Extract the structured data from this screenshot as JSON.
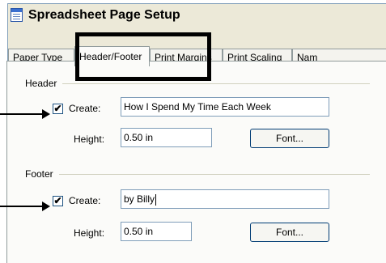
{
  "window": {
    "title": "Spreadsheet Page Setup"
  },
  "tabs": [
    {
      "label": "Paper Type"
    },
    {
      "label": "Header/Footer"
    },
    {
      "label": "Print Margins"
    },
    {
      "label": "Print Scaling"
    },
    {
      "label": "Nam"
    }
  ],
  "header": {
    "group_label": "Header",
    "create_label": "Create:",
    "create_checked": "✔",
    "text_value": "How I Spend My Time Each Week",
    "height_label": "Height:",
    "height_value": "0.50 in",
    "font_button": "Font..."
  },
  "footer": {
    "group_label": "Footer",
    "create_label": "Create:",
    "create_checked": "✔",
    "text_value": "by Billy",
    "height_label": "Height:",
    "height_value": "0.50 in",
    "font_button": "Font..."
  }
}
